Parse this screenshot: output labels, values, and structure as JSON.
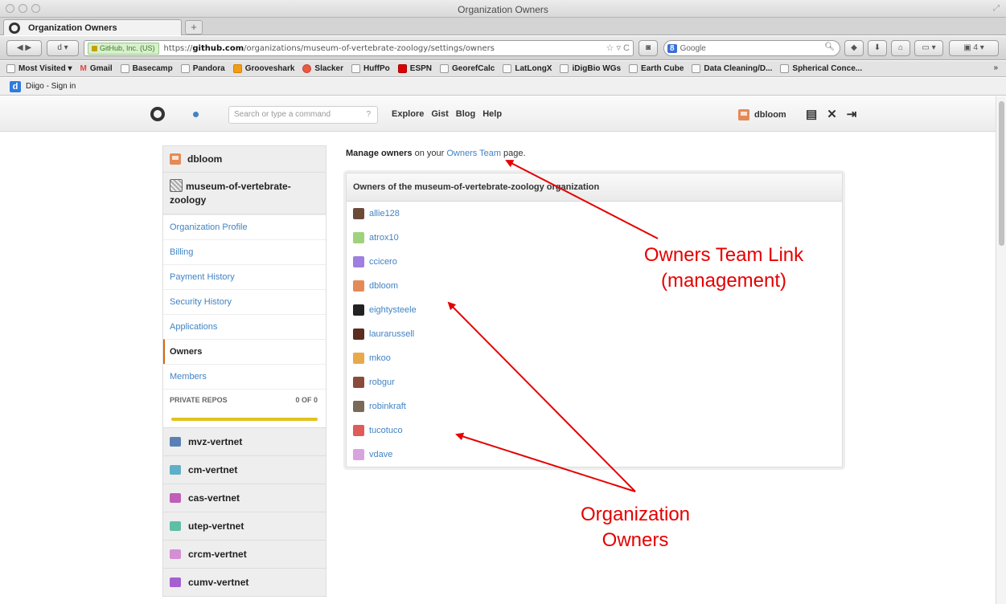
{
  "browser": {
    "window_title": "Organization Owners",
    "tab_label": "Organization Owners",
    "ssl_badge": "GitHub, Inc. (US)",
    "url_prefix": "https://",
    "url_host": "github.com",
    "url_path": "/organizations/museum-of-vertebrate-zoology/settings/owners",
    "search_engine": "Google",
    "bookmarks": [
      "Most Visited ▾",
      "Gmail",
      "Basecamp",
      "Pandora",
      "Grooveshark",
      "Slacker",
      "HuffPo",
      "ESPN",
      "GeorefCalc",
      "LatLongX",
      "iDigBio WGs",
      "Earth Cube",
      "Data Cleaning/D...",
      "Spherical Conce..."
    ],
    "bookmarks_more": "»",
    "diigo_label": "Diigo - Sign in"
  },
  "github_header": {
    "search_placeholder": "Search or type a command",
    "search_help": "?",
    "nav": [
      "Explore",
      "Gist",
      "Blog",
      "Help"
    ],
    "username": "dbloom"
  },
  "sidebar": {
    "user": "dbloom",
    "org": "museum-of-vertebrate-zoology",
    "items": [
      {
        "label": "Organization Profile"
      },
      {
        "label": "Billing"
      },
      {
        "label": "Payment History"
      },
      {
        "label": "Security History"
      },
      {
        "label": "Applications"
      },
      {
        "label": "Owners"
      },
      {
        "label": "Members"
      }
    ],
    "private_repos_label": "PRIVATE REPOS",
    "private_repos_count": "0 OF 0",
    "other_orgs": [
      {
        "name": "mvz-vertnet",
        "color": "#5a7fb5"
      },
      {
        "name": "cm-vertnet",
        "color": "#5fb0c7"
      },
      {
        "name": "cas-vertnet",
        "color": "#c05fb7"
      },
      {
        "name": "utep-vertnet",
        "color": "#5fbfa4"
      },
      {
        "name": "crcm-vertnet",
        "color": "#d48fd4"
      },
      {
        "name": "cumv-vertnet",
        "color": "#a55fd0"
      }
    ]
  },
  "main": {
    "manage_bold": "Manage owners",
    "manage_mid": " on your ",
    "manage_link": "Owners Team",
    "manage_end": " page.",
    "box_title": "Owners of the museum-of-vertebrate-zoology organization",
    "owners": [
      {
        "login": "allie128",
        "color": "#6b4a3a"
      },
      {
        "login": "atrox10",
        "color": "#9fd27c"
      },
      {
        "login": "ccicero",
        "color": "#9f7fe0"
      },
      {
        "login": "dbloom",
        "color": "#e48a58"
      },
      {
        "login": "eightysteele",
        "color": "#222222"
      },
      {
        "login": "laurarussell",
        "color": "#5a2d20"
      },
      {
        "login": "mkoo",
        "color": "#e8a94a"
      },
      {
        "login": "robgur",
        "color": "#8a4b3b"
      },
      {
        "login": "robinkraft",
        "color": "#7a6a5a"
      },
      {
        "login": "tucotuco",
        "color": "#e05b5b"
      },
      {
        "login": "vdave",
        "color": "#d9a3e0"
      }
    ]
  },
  "annotations": {
    "owners_team_link_1": "Owners Team Link",
    "owners_team_link_2": "(management)",
    "org_owners_1": "Organization",
    "org_owners_2": "Owners",
    "color": "#e50000"
  }
}
